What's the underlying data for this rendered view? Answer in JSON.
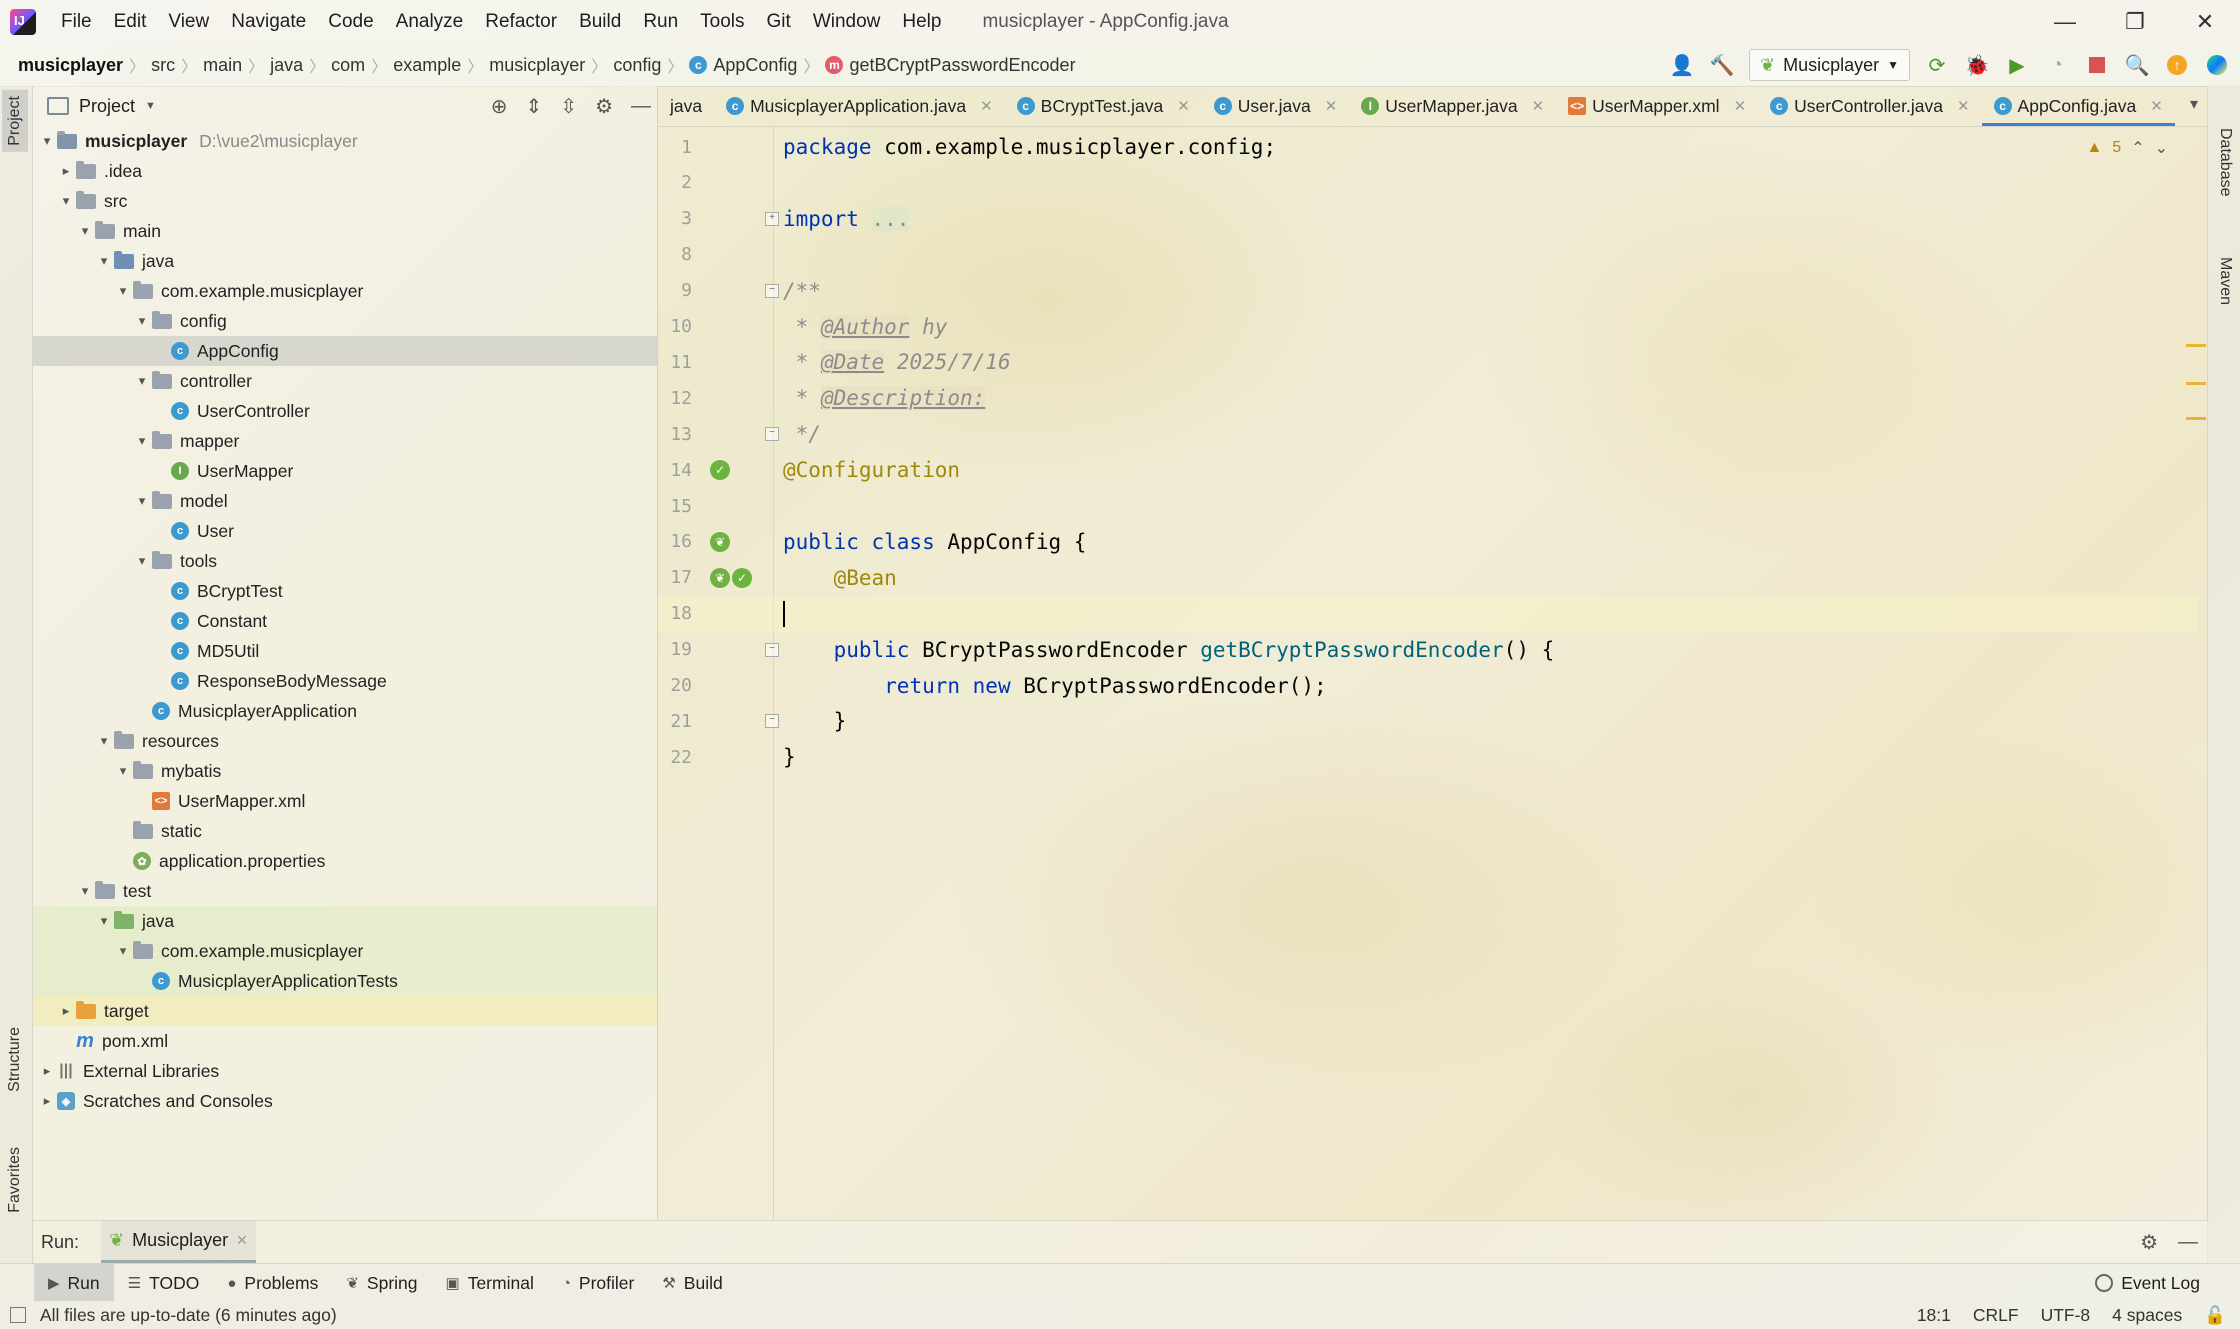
{
  "window": {
    "title": "musicplayer - AppConfig.java",
    "menu": [
      "File",
      "Edit",
      "View",
      "Navigate",
      "Code",
      "Analyze",
      "Refactor",
      "Build",
      "Run",
      "Tools",
      "Git",
      "Window",
      "Help"
    ],
    "controls": [
      "—",
      "❐",
      "✕"
    ]
  },
  "breadcrumbs": [
    "musicplayer",
    "src",
    "main",
    "java",
    "com",
    "example",
    "musicplayer",
    "config",
    "AppConfig",
    "getBCryptPasswordEncoder"
  ],
  "run_config": "Musicplayer",
  "left_strip": {
    "project": "Project",
    "structure": "Structure",
    "favorites": "Favorites"
  },
  "right_strip": {
    "database": "Database",
    "maven": "Maven"
  },
  "project_panel": {
    "title": "Project",
    "tree": [
      {
        "label": "musicplayer",
        "hint": "D:\\vue2\\musicplayer",
        "indent": 0,
        "arrow": "▾",
        "icon": "module-folder"
      },
      {
        "label": ".idea",
        "indent": 1,
        "arrow": "▸",
        "icon": "folder"
      },
      {
        "label": "src",
        "indent": 1,
        "arrow": "▾",
        "icon": "folder"
      },
      {
        "label": "main",
        "indent": 2,
        "arrow": "▾",
        "icon": "folder"
      },
      {
        "label": "java",
        "indent": 3,
        "arrow": "▾",
        "icon": "src-folder"
      },
      {
        "label": "com.example.musicplayer",
        "indent": 4,
        "arrow": "▾",
        "icon": "package"
      },
      {
        "label": "config",
        "indent": 5,
        "arrow": "▾",
        "icon": "package"
      },
      {
        "label": "AppConfig",
        "indent": 6,
        "arrow": "",
        "icon": "class",
        "selected": true
      },
      {
        "label": "controller",
        "indent": 5,
        "arrow": "▾",
        "icon": "package"
      },
      {
        "label": "UserController",
        "indent": 6,
        "arrow": "",
        "icon": "class"
      },
      {
        "label": "mapper",
        "indent": 5,
        "arrow": "▾",
        "icon": "package"
      },
      {
        "label": "UserMapper",
        "indent": 6,
        "arrow": "",
        "icon": "interface"
      },
      {
        "label": "model",
        "indent": 5,
        "arrow": "▾",
        "icon": "package"
      },
      {
        "label": "User",
        "indent": 6,
        "arrow": "",
        "icon": "class"
      },
      {
        "label": "tools",
        "indent": 5,
        "arrow": "▾",
        "icon": "package"
      },
      {
        "label": "BCryptTest",
        "indent": 6,
        "arrow": "",
        "icon": "class"
      },
      {
        "label": "Constant",
        "indent": 6,
        "arrow": "",
        "icon": "class"
      },
      {
        "label": "MD5Util",
        "indent": 6,
        "arrow": "",
        "icon": "class"
      },
      {
        "label": "ResponseBodyMessage",
        "indent": 6,
        "arrow": "",
        "icon": "class"
      },
      {
        "label": "MusicplayerApplication",
        "indent": 5,
        "arrow": "",
        "icon": "class"
      },
      {
        "label": "resources",
        "indent": 3,
        "arrow": "▾",
        "icon": "res-folder"
      },
      {
        "label": "mybatis",
        "indent": 4,
        "arrow": "▾",
        "icon": "folder"
      },
      {
        "label": "UserMapper.xml",
        "indent": 5,
        "arrow": "",
        "icon": "xml"
      },
      {
        "label": "static",
        "indent": 4,
        "arrow": "",
        "icon": "folder"
      },
      {
        "label": "application.properties",
        "indent": 4,
        "arrow": "",
        "icon": "properties"
      },
      {
        "label": "test",
        "indent": 2,
        "arrow": "▾",
        "icon": "folder"
      },
      {
        "label": "java",
        "indent": 3,
        "arrow": "▾",
        "icon": "test-folder",
        "green": true
      },
      {
        "label": "com.example.musicplayer",
        "indent": 4,
        "arrow": "▾",
        "icon": "package",
        "green": true
      },
      {
        "label": "MusicplayerApplicationTests",
        "indent": 5,
        "arrow": "",
        "icon": "class",
        "green": true
      },
      {
        "label": "target",
        "indent": 1,
        "arrow": "▸",
        "icon": "target-folder",
        "yellow": true
      },
      {
        "label": "pom.xml",
        "indent": 1,
        "arrow": "",
        "icon": "maven"
      },
      {
        "label": "External Libraries",
        "indent": 0,
        "arrow": "▸",
        "icon": "library"
      },
      {
        "label": "Scratches and Consoles",
        "indent": 0,
        "arrow": "▸",
        "icon": "scratch"
      }
    ]
  },
  "editor": {
    "tabs": [
      {
        "label": "java",
        "icon": "",
        "closable": false
      },
      {
        "label": "MusicplayerApplication.java",
        "icon": "class",
        "closable": true
      },
      {
        "label": "BCryptTest.java",
        "icon": "class",
        "closable": true
      },
      {
        "label": "User.java",
        "icon": "class",
        "closable": true
      },
      {
        "label": "UserMapper.java",
        "icon": "interface",
        "closable": true
      },
      {
        "label": "UserMapper.xml",
        "icon": "xml",
        "closable": true
      },
      {
        "label": "UserController.java",
        "icon": "class",
        "closable": true
      },
      {
        "label": "AppConfig.java",
        "icon": "class",
        "closable": true,
        "active": true
      }
    ],
    "warnings": "5",
    "lines": [
      {
        "num": "1",
        "html": "<span class='kw'>package</span> com.example.musicplayer.config;"
      },
      {
        "num": "2",
        "html": ""
      },
      {
        "num": "3",
        "html": "<span class='kw'>import</span> <span class='cm' style='font-style:normal;background:rgba(220,230,200,.6)'>...</span>"
      },
      {
        "num": "8",
        "html": ""
      },
      {
        "num": "9",
        "html": "<span class='cm'>/**</span>"
      },
      {
        "num": "10",
        "html": "<span class='cm'> * </span><span class='tag'>@Author</span><span class='cm'> hy</span>"
      },
      {
        "num": "11",
        "html": "<span class='cm'> * </span><span class='tag'>@Date</span><span class='cm'> 2025/7/16</span>"
      },
      {
        "num": "12",
        "html": "<span class='cm'> * </span><span class='tag'>@Description:</span><span class='cm'> </span>"
      },
      {
        "num": "13",
        "html": "<span class='cm'> */</span>"
      },
      {
        "num": "14",
        "html": "<span class='ann'>@Configuration</span>"
      },
      {
        "num": "15",
        "html": ""
      },
      {
        "num": "16",
        "html": "<span class='kw'>public class</span> AppConfig {"
      },
      {
        "num": "17",
        "html": "    <span class='ann'>@Bean</span>"
      },
      {
        "num": "18",
        "html": ""
      },
      {
        "num": "19",
        "html": "    <span class='kw'>public</span> BCryptPasswordEncoder <span class='fn'>getBCryptPasswordEncoder</span>() {"
      },
      {
        "num": "20",
        "html": "        <span class='kw'>return new</span> BCryptPasswordEncoder();"
      },
      {
        "num": "21",
        "html": "    }"
      },
      {
        "num": "22",
        "html": "}"
      }
    ]
  },
  "run_bar": {
    "label": "Run:",
    "tab": "Musicplayer"
  },
  "tool_windows": [
    {
      "label": "Run",
      "icon": "▶",
      "active": true
    },
    {
      "label": "TODO",
      "icon": "☰"
    },
    {
      "label": "Problems",
      "icon": "●"
    },
    {
      "label": "Spring",
      "icon": "❦"
    },
    {
      "label": "Terminal",
      "icon": "▣"
    },
    {
      "label": "Profiler",
      "icon": "◔"
    },
    {
      "label": "Build",
      "icon": "⚒"
    }
  ],
  "event_log": "Event Log",
  "status": {
    "message": "All files are up-to-date (6 minutes ago)",
    "position": "18:1",
    "line_sep": "CRLF",
    "encoding": "UTF-8",
    "indent": "4 spaces"
  }
}
